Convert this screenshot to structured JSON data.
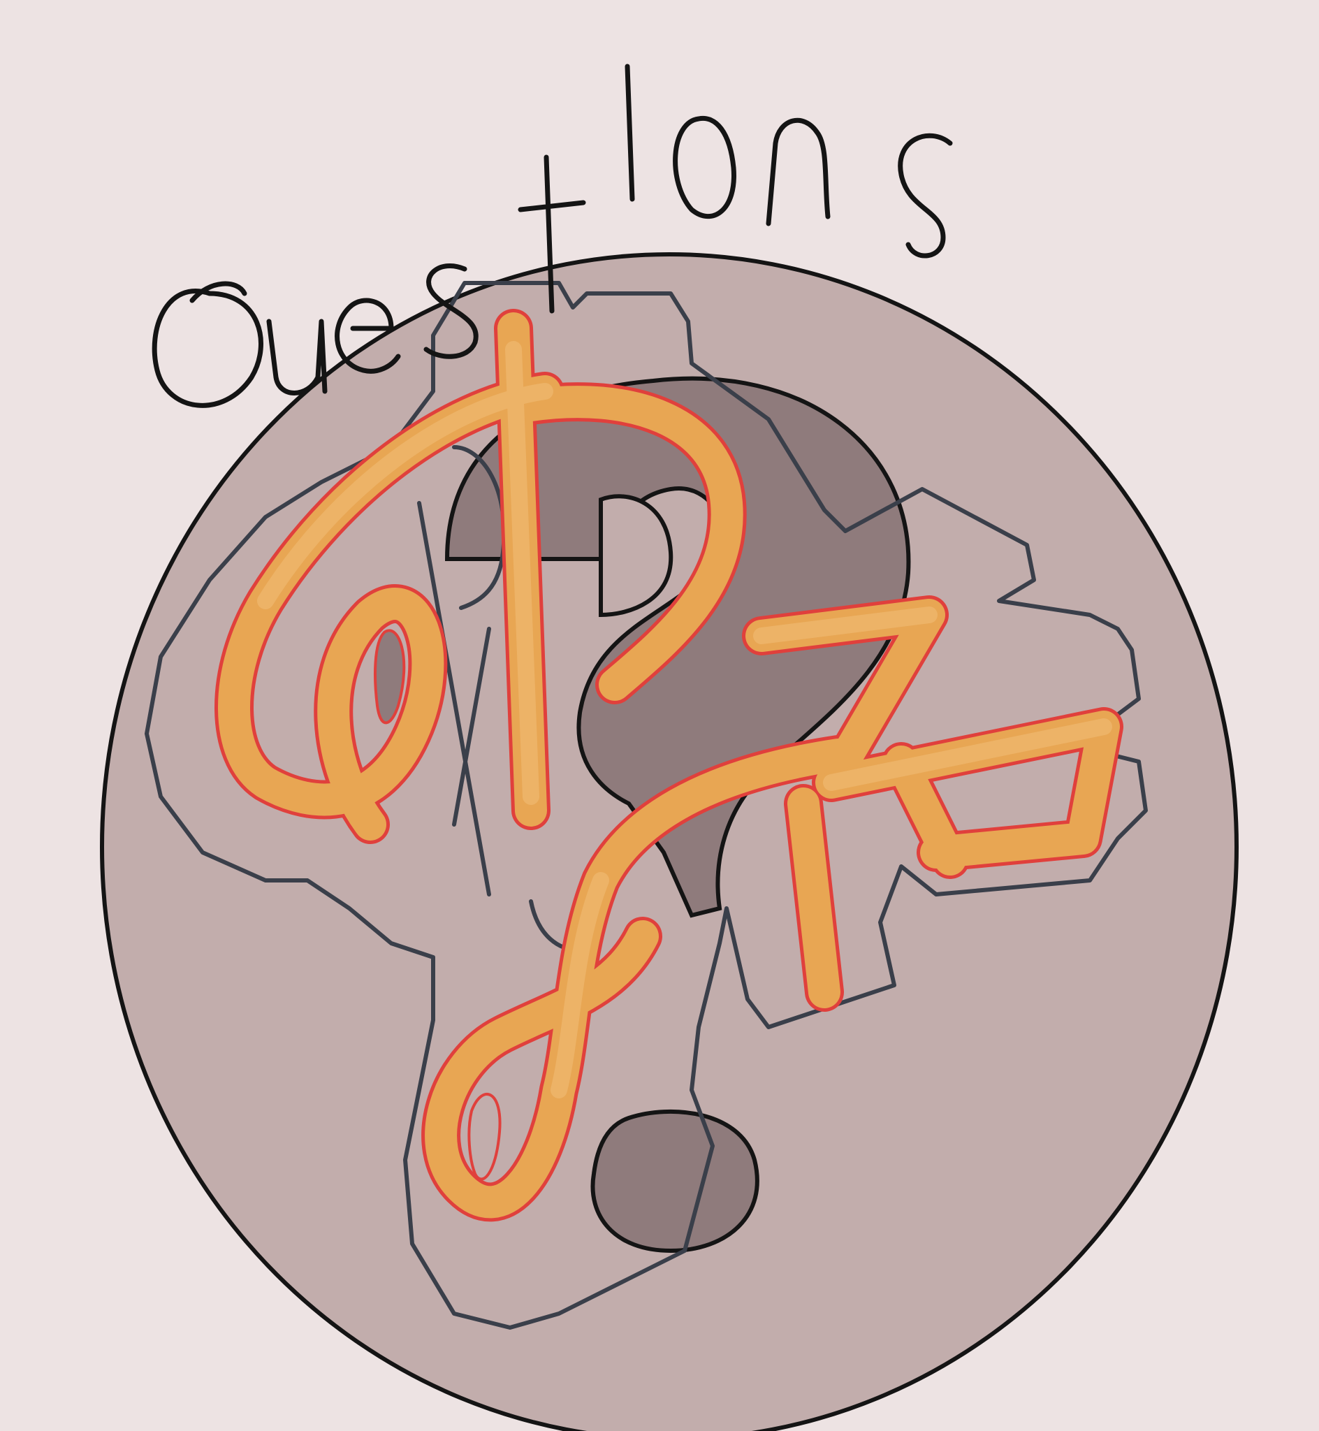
{
  "logo": {
    "heading_text": "Questions",
    "monogram_text": "QPZ",
    "colors": {
      "background": "#ede3e3",
      "disc": "#c2adac",
      "question_mark_shadow": "#8f7b7c",
      "letter_fill": "#e8a653",
      "letter_edge": "#e0403c",
      "ink": "#141414",
      "grey_outline": "#3a3f4a"
    }
  }
}
